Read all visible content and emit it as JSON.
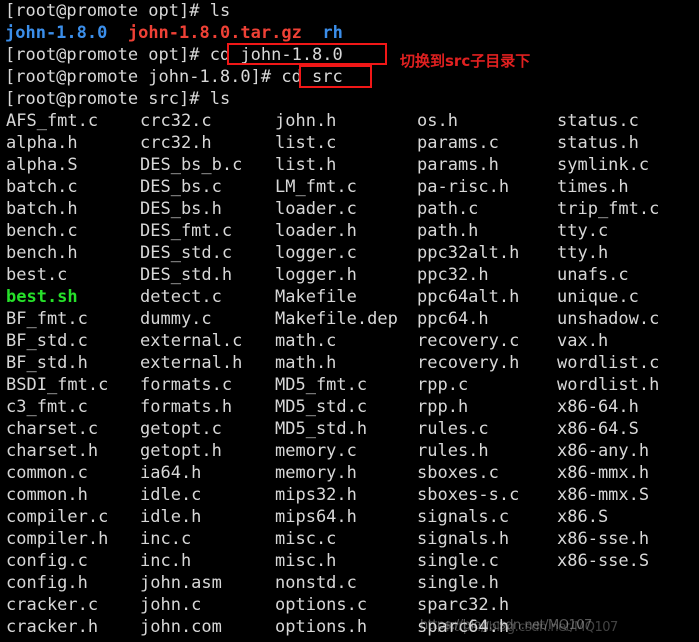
{
  "terminal": {
    "background_color": "#000000",
    "foreground_color": "#d8d8d8",
    "dir_color": "#3b8eea",
    "archive_color": "#ef4136",
    "exec_color": "#26e02a",
    "annotation_color": "#e02020"
  },
  "session": {
    "line1_prompt": "[root@promote opt]# ",
    "line1_command": "ls",
    "line2_items": [
      {
        "text": "john-1.8.0",
        "type": "dir"
      },
      {
        "text": "  ",
        "type": "plain"
      },
      {
        "text": "john-1.8.0.tar.gz",
        "type": "archive"
      },
      {
        "text": "  ",
        "type": "plain"
      },
      {
        "text": "rh",
        "type": "dir"
      }
    ],
    "line3_prompt": "[root@promote opt]# ",
    "line3_command": "cd john-1.8.0",
    "line4_prompt": "[root@promote john-1.8.0]# ",
    "line4_command": "cd src",
    "line5_prompt": "[root@promote src]# ",
    "line5_command": "ls"
  },
  "annotations": {
    "note_src": "切换到src子目录下",
    "watermark_1": "https://blog.csdn.net/MQ107",
    "watermark_2": "https://blog.csdn.net/MQ107"
  },
  "listing": {
    "columns": [
      {
        "name": "column-1",
        "files": [
          {
            "name": "AFS_fmt.c",
            "type": "file"
          },
          {
            "name": "alpha.h",
            "type": "file"
          },
          {
            "name": "alpha.S",
            "type": "file"
          },
          {
            "name": "batch.c",
            "type": "file"
          },
          {
            "name": "batch.h",
            "type": "file"
          },
          {
            "name": "bench.c",
            "type": "file"
          },
          {
            "name": "bench.h",
            "type": "file"
          },
          {
            "name": "best.c",
            "type": "file"
          },
          {
            "name": "best.sh",
            "type": "exec"
          },
          {
            "name": "BF_fmt.c",
            "type": "file"
          },
          {
            "name": "BF_std.c",
            "type": "file"
          },
          {
            "name": "BF_std.h",
            "type": "file"
          },
          {
            "name": "BSDI_fmt.c",
            "type": "file"
          },
          {
            "name": "c3_fmt.c",
            "type": "file"
          },
          {
            "name": "charset.c",
            "type": "file"
          },
          {
            "name": "charset.h",
            "type": "file"
          },
          {
            "name": "common.c",
            "type": "file"
          },
          {
            "name": "common.h",
            "type": "file"
          },
          {
            "name": "compiler.c",
            "type": "file"
          },
          {
            "name": "compiler.h",
            "type": "file"
          },
          {
            "name": "config.c",
            "type": "file"
          },
          {
            "name": "config.h",
            "type": "file"
          },
          {
            "name": "cracker.c",
            "type": "file"
          },
          {
            "name": "cracker.h",
            "type": "file"
          }
        ]
      },
      {
        "name": "column-2",
        "files": [
          {
            "name": "crc32.c",
            "type": "file"
          },
          {
            "name": "crc32.h",
            "type": "file"
          },
          {
            "name": "DES_bs_b.c",
            "type": "file"
          },
          {
            "name": "DES_bs.c",
            "type": "file"
          },
          {
            "name": "DES_bs.h",
            "type": "file"
          },
          {
            "name": "DES_fmt.c",
            "type": "file"
          },
          {
            "name": "DES_std.c",
            "type": "file"
          },
          {
            "name": "DES_std.h",
            "type": "file"
          },
          {
            "name": "detect.c",
            "type": "file"
          },
          {
            "name": "dummy.c",
            "type": "file"
          },
          {
            "name": "external.c",
            "type": "file"
          },
          {
            "name": "external.h",
            "type": "file"
          },
          {
            "name": "formats.c",
            "type": "file"
          },
          {
            "name": "formats.h",
            "type": "file"
          },
          {
            "name": "getopt.c",
            "type": "file"
          },
          {
            "name": "getopt.h",
            "type": "file"
          },
          {
            "name": "ia64.h",
            "type": "file"
          },
          {
            "name": "idle.c",
            "type": "file"
          },
          {
            "name": "idle.h",
            "type": "file"
          },
          {
            "name": "inc.c",
            "type": "file"
          },
          {
            "name": "inc.h",
            "type": "file"
          },
          {
            "name": "john.asm",
            "type": "file"
          },
          {
            "name": "john.c",
            "type": "file"
          },
          {
            "name": "john.com",
            "type": "file"
          }
        ]
      },
      {
        "name": "column-3",
        "files": [
          {
            "name": "john.h",
            "type": "file"
          },
          {
            "name": "list.c",
            "type": "file"
          },
          {
            "name": "list.h",
            "type": "file"
          },
          {
            "name": "LM_fmt.c",
            "type": "file"
          },
          {
            "name": "loader.c",
            "type": "file"
          },
          {
            "name": "loader.h",
            "type": "file"
          },
          {
            "name": "logger.c",
            "type": "file"
          },
          {
            "name": "logger.h",
            "type": "file"
          },
          {
            "name": "Makefile",
            "type": "file"
          },
          {
            "name": "Makefile.dep",
            "type": "file"
          },
          {
            "name": "math.c",
            "type": "file"
          },
          {
            "name": "math.h",
            "type": "file"
          },
          {
            "name": "MD5_fmt.c",
            "type": "file"
          },
          {
            "name": "MD5_std.c",
            "type": "file"
          },
          {
            "name": "MD5_std.h",
            "type": "file"
          },
          {
            "name": "memory.c",
            "type": "file"
          },
          {
            "name": "memory.h",
            "type": "file"
          },
          {
            "name": "mips32.h",
            "type": "file"
          },
          {
            "name": "mips64.h",
            "type": "file"
          },
          {
            "name": "misc.c",
            "type": "file"
          },
          {
            "name": "misc.h",
            "type": "file"
          },
          {
            "name": "nonstd.c",
            "type": "file"
          },
          {
            "name": "options.c",
            "type": "file"
          },
          {
            "name": "options.h",
            "type": "file"
          }
        ]
      },
      {
        "name": "column-4",
        "files": [
          {
            "name": "os.h",
            "type": "file"
          },
          {
            "name": "params.c",
            "type": "file"
          },
          {
            "name": "params.h",
            "type": "file"
          },
          {
            "name": "pa-risc.h",
            "type": "file"
          },
          {
            "name": "path.c",
            "type": "file"
          },
          {
            "name": "path.h",
            "type": "file"
          },
          {
            "name": "ppc32alt.h",
            "type": "file"
          },
          {
            "name": "ppc32.h",
            "type": "file"
          },
          {
            "name": "ppc64alt.h",
            "type": "file"
          },
          {
            "name": "ppc64.h",
            "type": "file"
          },
          {
            "name": "recovery.c",
            "type": "file"
          },
          {
            "name": "recovery.h",
            "type": "file"
          },
          {
            "name": "rpp.c",
            "type": "file"
          },
          {
            "name": "rpp.h",
            "type": "file"
          },
          {
            "name": "rules.c",
            "type": "file"
          },
          {
            "name": "rules.h",
            "type": "file"
          },
          {
            "name": "sboxes.c",
            "type": "file"
          },
          {
            "name": "sboxes-s.c",
            "type": "file"
          },
          {
            "name": "signals.c",
            "type": "file"
          },
          {
            "name": "signals.h",
            "type": "file"
          },
          {
            "name": "single.c",
            "type": "file"
          },
          {
            "name": "single.h",
            "type": "file"
          },
          {
            "name": "sparc32.h",
            "type": "file"
          },
          {
            "name": "sparc64.h",
            "type": "file"
          }
        ]
      },
      {
        "name": "column-5",
        "files": [
          {
            "name": "status.c",
            "type": "file"
          },
          {
            "name": "status.h",
            "type": "file"
          },
          {
            "name": "symlink.c",
            "type": "file"
          },
          {
            "name": "times.h",
            "type": "file"
          },
          {
            "name": "trip_fmt.c",
            "type": "file"
          },
          {
            "name": "tty.c",
            "type": "file"
          },
          {
            "name": "tty.h",
            "type": "file"
          },
          {
            "name": "unafs.c",
            "type": "file"
          },
          {
            "name": "unique.c",
            "type": "file"
          },
          {
            "name": "unshadow.c",
            "type": "file"
          },
          {
            "name": "vax.h",
            "type": "file"
          },
          {
            "name": "wordlist.c",
            "type": "file"
          },
          {
            "name": "wordlist.h",
            "type": "file"
          },
          {
            "name": "x86-64.h",
            "type": "file"
          },
          {
            "name": "x86-64.S",
            "type": "file"
          },
          {
            "name": "x86-any.h",
            "type": "file"
          },
          {
            "name": "x86-mmx.h",
            "type": "file"
          },
          {
            "name": "x86-mmx.S",
            "type": "file"
          },
          {
            "name": "x86.S",
            "type": "file"
          },
          {
            "name": "x86-sse.h",
            "type": "file"
          },
          {
            "name": "x86-sse.S",
            "type": "file"
          }
        ]
      }
    ]
  }
}
